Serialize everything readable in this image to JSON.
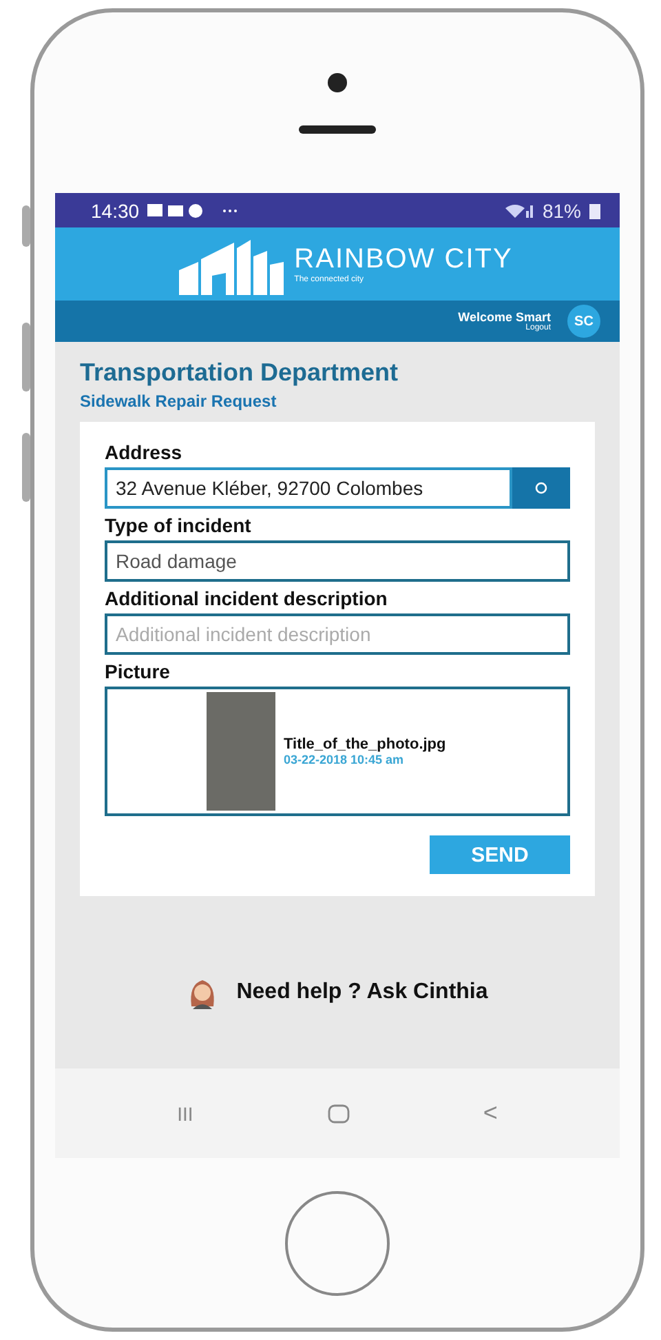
{
  "status_bar": {
    "time": "14:30",
    "battery": "81%"
  },
  "header": {
    "logo_title": "RAINBOW CITY",
    "logo_tagline": "The connected city"
  },
  "user_bar": {
    "welcome": "Welcome Smart",
    "logout": "Logout",
    "avatar_initials": "SC"
  },
  "page": {
    "title": "Transportation Department",
    "subtitle": "Sidewalk Repair Request"
  },
  "form": {
    "fields": [
      {
        "kind": "address",
        "label": "Address",
        "value": "32 Avenue Kléber, 92700 Colombes"
      },
      {
        "kind": "text",
        "label": "Type of incident",
        "value": "Road damage"
      },
      {
        "kind": "text",
        "label": "Additional incident description",
        "placeholder": "Additional incident description"
      },
      {
        "kind": "picture",
        "label": "Picture",
        "file_name": "Title_of_the_photo.jpg",
        "date": "03-22-2018 10:45 am"
      }
    ],
    "submit": "SEND"
  },
  "help": {
    "text": "Need help ? Ask Cinthia"
  },
  "nav_bar": {
    "recents": "III",
    "back": "<"
  }
}
